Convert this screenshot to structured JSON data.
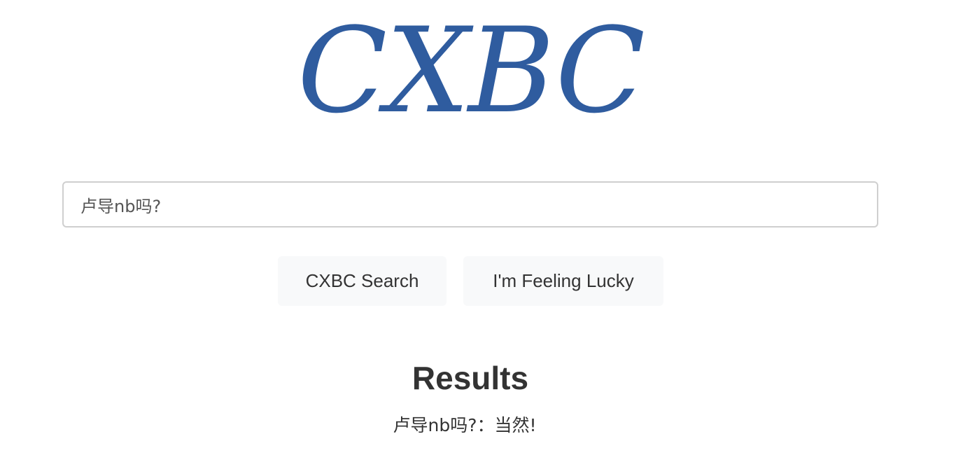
{
  "logo": {
    "text": "CXBC",
    "color": "#2f5c9f"
  },
  "search": {
    "value": "卢导nb吗?",
    "placeholder": ""
  },
  "buttons": {
    "search_label": "CXBC Search",
    "lucky_label": "I'm Feeling Lucky"
  },
  "results": {
    "title": "Results",
    "items": [
      {
        "text": "卢导nb吗?：当然!"
      }
    ]
  }
}
